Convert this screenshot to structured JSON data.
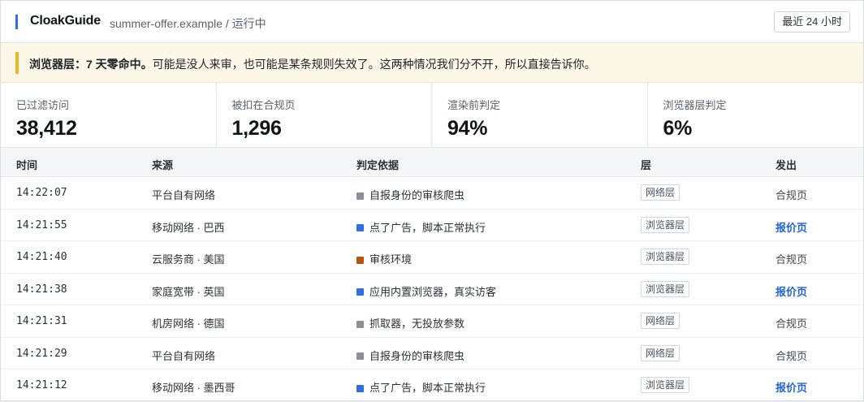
{
  "header": {
    "brand": "CloakGuide",
    "site": "summer-offer.example / 运行中",
    "range_button": "最近 24 小时"
  },
  "banner": {
    "bold": "浏览器层：7 天零命中。",
    "text": "可能是没人来审，也可能是某条规则失效了。这两种情况我们分不开，所以直接告诉你。"
  },
  "stats": [
    {
      "label": "已过滤访问",
      "value": "38,412"
    },
    {
      "label": "被扣在合规页",
      "value": "1,296"
    },
    {
      "label": "渲染前判定",
      "value": "94%"
    },
    {
      "label": "浏览器层判定",
      "value": "6%"
    }
  ],
  "table": {
    "headers": {
      "time": "时间",
      "source": "来源",
      "reason": "判定依据",
      "layer": "层",
      "output": "发出"
    },
    "rows": [
      {
        "time": "14:22:07",
        "source": "平台自有网络",
        "reason": "自报身份的审核爬虫",
        "dot": "#8a8f98",
        "layer": "网络层",
        "output": "合规页",
        "kind": "compliance"
      },
      {
        "time": "14:21:55",
        "source": "移动网络 · 巴西",
        "reason": "点了广告，脚本正常执行",
        "dot": "#2f6fdf",
        "layer": "浏览器层",
        "output": "报价页",
        "kind": "offer"
      },
      {
        "time": "14:21:40",
        "source": "云服务商 · 美国",
        "reason": "审核环境",
        "dot": "#b5530f",
        "layer": "浏览器层",
        "output": "合规页",
        "kind": "compliance"
      },
      {
        "time": "14:21:38",
        "source": "家庭宽带 · 英国",
        "reason": "应用内置浏览器，真实访客",
        "dot": "#2f6fdf",
        "layer": "浏览器层",
        "output": "报价页",
        "kind": "offer"
      },
      {
        "time": "14:21:31",
        "source": "机房网络 · 德国",
        "reason": "抓取器，无投放参数",
        "dot": "#8a8f98",
        "layer": "网络层",
        "output": "合规页",
        "kind": "compliance"
      },
      {
        "time": "14:21:29",
        "source": "平台自有网络",
        "reason": "自报身份的审核爬虫",
        "dot": "#8a8f98",
        "layer": "网络层",
        "output": "合规页",
        "kind": "compliance"
      },
      {
        "time": "14:21:12",
        "source": "移动网络 · 墨西哥",
        "reason": "点了广告，脚本正常执行",
        "dot": "#2f6fdf",
        "layer": "浏览器层",
        "output": "报价页",
        "kind": "offer"
      }
    ]
  }
}
